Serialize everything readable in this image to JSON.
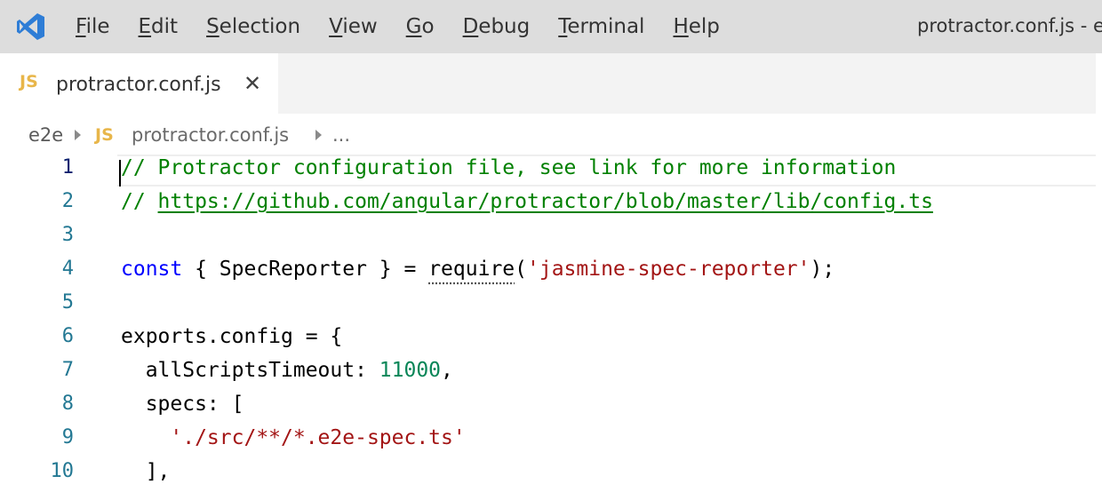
{
  "titlebar": {
    "menu": [
      {
        "mnemonic": "F",
        "rest": "ile"
      },
      {
        "mnemonic": "E",
        "rest": "dit"
      },
      {
        "mnemonic": "S",
        "rest": "election"
      },
      {
        "mnemonic": "V",
        "rest": "iew"
      },
      {
        "mnemonic": "G",
        "rest": "o"
      },
      {
        "mnemonic": "D",
        "rest": "ebug"
      },
      {
        "mnemonic": "T",
        "rest": "erminal"
      },
      {
        "mnemonic": "H",
        "rest": "elp"
      }
    ],
    "window_title": "protractor.conf.js - e"
  },
  "tab": {
    "badge": "JS",
    "label": "protractor.conf.js",
    "close": "✕"
  },
  "breadcrumb": {
    "folder": "e2e",
    "badge": "JS",
    "file": "protractor.conf.js",
    "more": "..."
  },
  "editor": {
    "lines": [
      {
        "num": "1",
        "c1": "// Protractor configuration file, see link for more information"
      },
      {
        "num": "2",
        "c1": "// ",
        "c2": "https://github.com/angular/protractor/blob/master/lib/config.ts"
      },
      {
        "num": "3"
      },
      {
        "num": "4",
        "c1": "const",
        "c2": " { SpecReporter } = ",
        "c3": "require",
        "c4": "(",
        "c5": "'jasmine-spec-reporter'",
        "c6": ");"
      },
      {
        "num": "5"
      },
      {
        "num": "6",
        "c1": "exports.config = {"
      },
      {
        "num": "7",
        "c1": "  allScriptsTimeout: ",
        "c2": "11000",
        "c3": ","
      },
      {
        "num": "8",
        "c1": "  specs: ["
      },
      {
        "num": "9",
        "c1": "    ",
        "c2": "'./src/**/*.e2e-spec.ts'"
      },
      {
        "num": "10",
        "c1": "  ],"
      }
    ]
  },
  "colors": {
    "comment": "#008000",
    "keyword": "#0000ff",
    "string": "#a31515",
    "number": "#098658",
    "line_number": "#237893",
    "js_badge": "#e8b64a"
  }
}
